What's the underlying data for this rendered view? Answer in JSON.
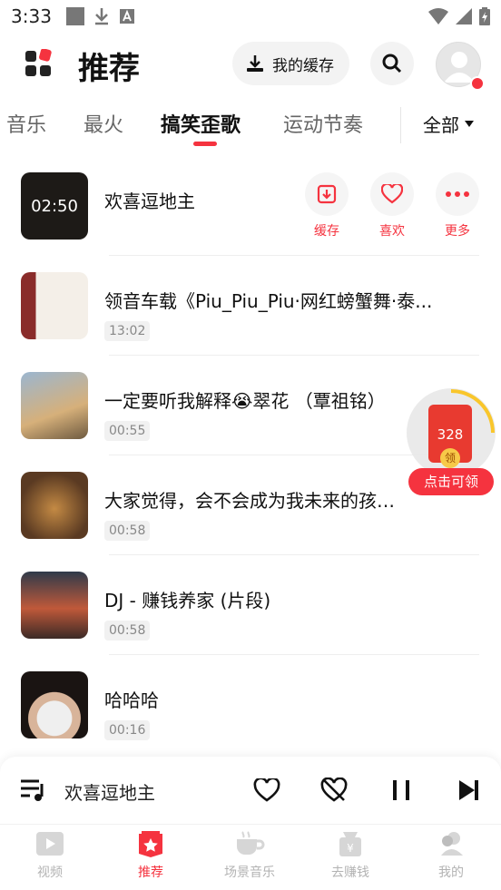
{
  "status_bar": {
    "time": "3:33"
  },
  "header": {
    "title": "推荐",
    "cache_label": "我的缓存"
  },
  "tabs": {
    "items": [
      {
        "label": "音乐"
      },
      {
        "label": "最火"
      },
      {
        "label": "搞笑歪歌"
      },
      {
        "label": "运动节奏"
      }
    ],
    "active_index": 2,
    "all_label": "全部"
  },
  "songs": [
    {
      "title": "欢喜逗地主",
      "duration": "02:50"
    },
    {
      "title": "领音车载《Piu_Piu_Piu·网红螃蟹舞·泰...",
      "duration": "13:02"
    },
    {
      "title": "一定要听我解释😭翠花   （覃祖铭）",
      "duration": "00:55"
    },
    {
      "title": "大家觉得，会不会成为我未来的孩他妈",
      "duration": "00:58"
    },
    {
      "title": "DJ - 赚钱养家 (片段)",
      "duration": "00:58"
    },
    {
      "title": "哈哈哈",
      "duration": "00:16"
    }
  ],
  "actions": {
    "cache": "缓存",
    "like": "喜欢",
    "more": "更多"
  },
  "reward": {
    "count": "328",
    "coin": "领",
    "button": "点击可领"
  },
  "player": {
    "title": "欢喜逗地主"
  },
  "bottom_nav": [
    {
      "label": "视频",
      "icon": "video-icon"
    },
    {
      "label": "推荐",
      "icon": "recommend-icon"
    },
    {
      "label": "场景音乐",
      "icon": "coffee-icon"
    },
    {
      "label": "去赚钱",
      "icon": "money-bag-icon"
    },
    {
      "label": "我的",
      "icon": "profile-icon"
    }
  ],
  "colors": {
    "accent": "#f5333f"
  }
}
